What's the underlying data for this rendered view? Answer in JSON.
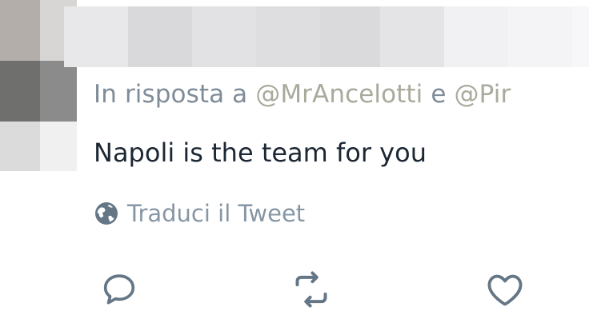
{
  "tweet": {
    "reply_prefix": "In risposta a",
    "mention_1": "@MrAncelotti",
    "conjunction": "e",
    "mention_2": "@Pir",
    "text": "Napoli is the team for you",
    "translate_label": "Traduci il Tweet"
  },
  "icons": {
    "translate": "globe-icon",
    "reply": "reply-icon",
    "retweet": "retweet-icon",
    "like": "heart-icon"
  },
  "colors": {
    "text": "#1c2733",
    "muted": "#8796a4",
    "mention": "#a9a99c",
    "icon": "#657786"
  }
}
